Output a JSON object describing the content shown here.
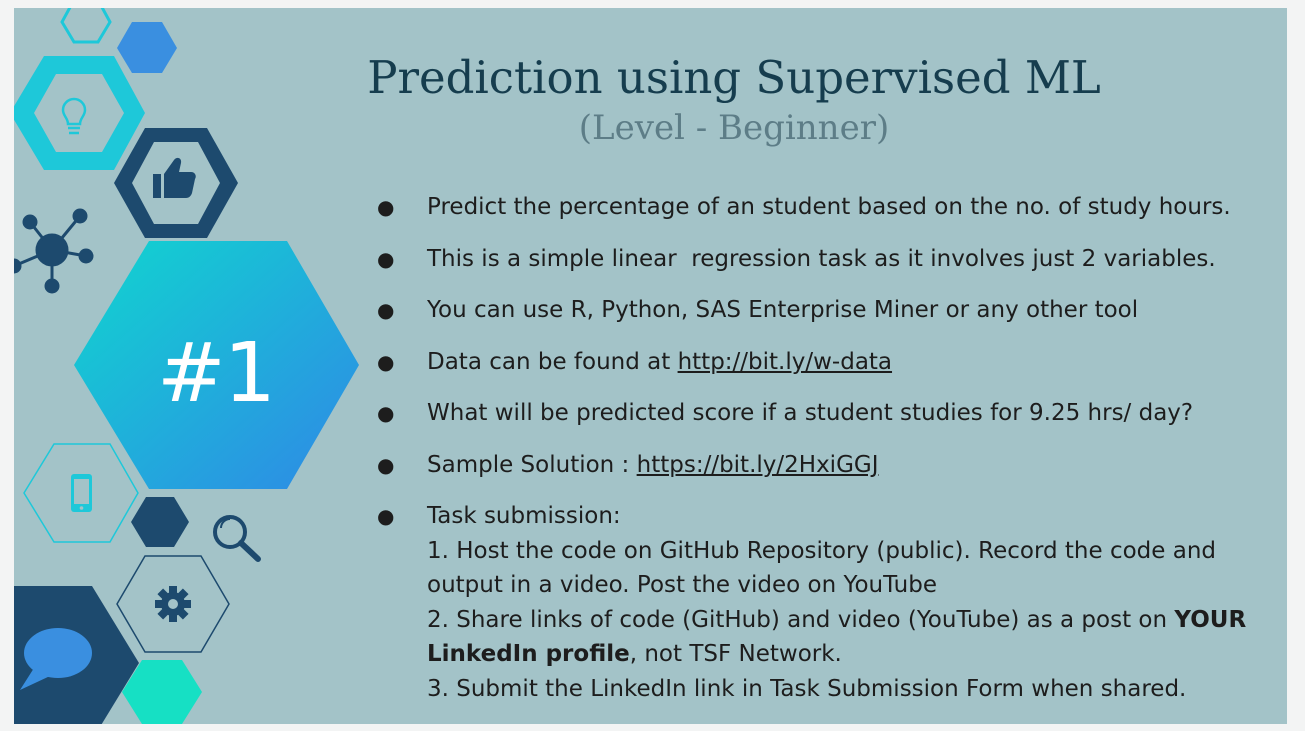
{
  "slide": {
    "number": "#1",
    "title": "Prediction using Supervised ML",
    "subtitle": "(Level - Beginner)"
  },
  "bullets": {
    "b1": "Predict the percentage of an student based on the no. of study hours.",
    "b2": "This is a simple linear  regression task as it involves just 2 variables.",
    "b3": "You can use R, Python, SAS Enterprise Miner or any other tool",
    "b4_prefix": "Data can be found at ",
    "b4_link": "http://bit.ly/w-data",
    "b5": "What will be predicted score if a student studies for 9.25 hrs/ day?",
    "b6_prefix": "Sample Solution : ",
    "b6_link": "https://bit.ly/2HxiGGJ",
    "b7_head": "Task submission:",
    "b7_step1": "1. Host the code on GitHub Repository (public). Record the code and output in a video. Post the video on YouTube",
    "b7_step2_prefix": "2. Share links of code (GitHub) and video (YouTube) as a post on ",
    "b7_step2_bold": "YOUR LinkedIn profile",
    "b7_step2_suffix": ", not TSF Network.",
    "b7_step3": "3. Submit the LinkedIn link in Task Submission Form when shared.",
    "marker": "●"
  },
  "colors": {
    "slide_bg": "#a3c3c8",
    "title": "#163d4e",
    "subtitle": "#5d7d87",
    "navy": "#1d4a6e",
    "cyan": "#1ec8d9",
    "blue": "#3a8fe0",
    "teal": "#16e0c4"
  },
  "icons": [
    "lightbulb-icon",
    "thumbs-up-icon",
    "network-icon",
    "smartphone-icon",
    "magnifier-icon",
    "gear-icon",
    "chat-bubble-icon"
  ]
}
